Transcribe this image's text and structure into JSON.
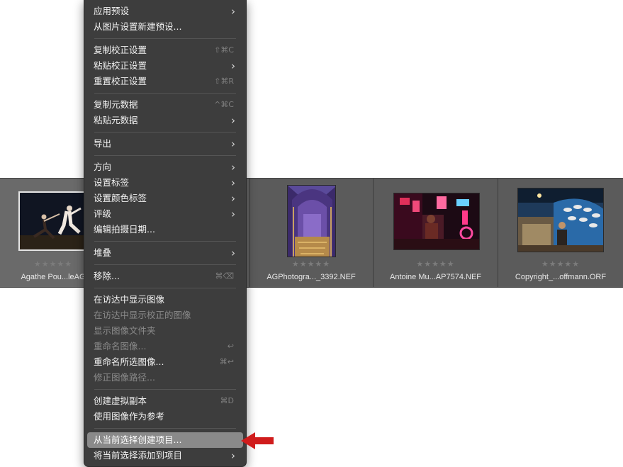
{
  "menu": {
    "items": [
      {
        "label": "应用预设",
        "submenu": true
      },
      {
        "label": "从图片设置新建预设..."
      },
      {
        "label": "复制校正设置",
        "shortcut": "⇧⌘C"
      },
      {
        "label": "粘贴校正设置",
        "submenu": true
      },
      {
        "label": "重置校正设置",
        "shortcut": "⇧⌘R"
      },
      {
        "label": "复制元数据",
        "shortcut": "^⌘C"
      },
      {
        "label": "粘贴元数据",
        "submenu": true
      },
      {
        "label": "导出",
        "submenu": true
      },
      {
        "label": "方向",
        "submenu": true
      },
      {
        "label": "设置标签",
        "submenu": true
      },
      {
        "label": "设置颜色标签",
        "submenu": true
      },
      {
        "label": "评级",
        "submenu": true
      },
      {
        "label": "编辑拍摄日期..."
      },
      {
        "label": "堆叠",
        "submenu": true
      },
      {
        "label": "移除...",
        "shortcut": "⌘⌫"
      },
      {
        "label": "在访达中显示图像"
      },
      {
        "label": "在访达中显示校正的图像",
        "disabled": true
      },
      {
        "label": "显示图像文件夹",
        "disabled": true
      },
      {
        "label": "重命名图像...",
        "disabled": true,
        "shortcut": "↩"
      },
      {
        "label": "重命名所选图像...",
        "shortcut": "⌘↩"
      },
      {
        "label": "修正图像路径...",
        "disabled": true
      },
      {
        "label": "创建虚拟副本",
        "shortcut": "⌘D"
      },
      {
        "label": "使用图像作为参考"
      },
      {
        "label": "从当前选择创建项目...",
        "highlighted": true
      },
      {
        "label": "将当前选择添加到项目",
        "submenu": true
      }
    ]
  },
  "filmstrip": {
    "items": [
      {
        "filename": "Agathe Pou...leAG",
        "rating": "★★★★★",
        "selected": true
      },
      {
        "filename": "AGPhotogra..._3392.NEF",
        "rating": "★★★★★"
      },
      {
        "filename": "Antoine Mu...AP7574.NEF",
        "rating": "★★★★★"
      },
      {
        "filename": "Copyright_...offmann.ORF",
        "rating": "★★★★★"
      }
    ]
  },
  "colors": {
    "menu_bg": "#3d3d3d",
    "highlight": "#8a8a8a",
    "filmstrip_bg": "#5b5b5b",
    "pointer": "#d01c1c"
  }
}
